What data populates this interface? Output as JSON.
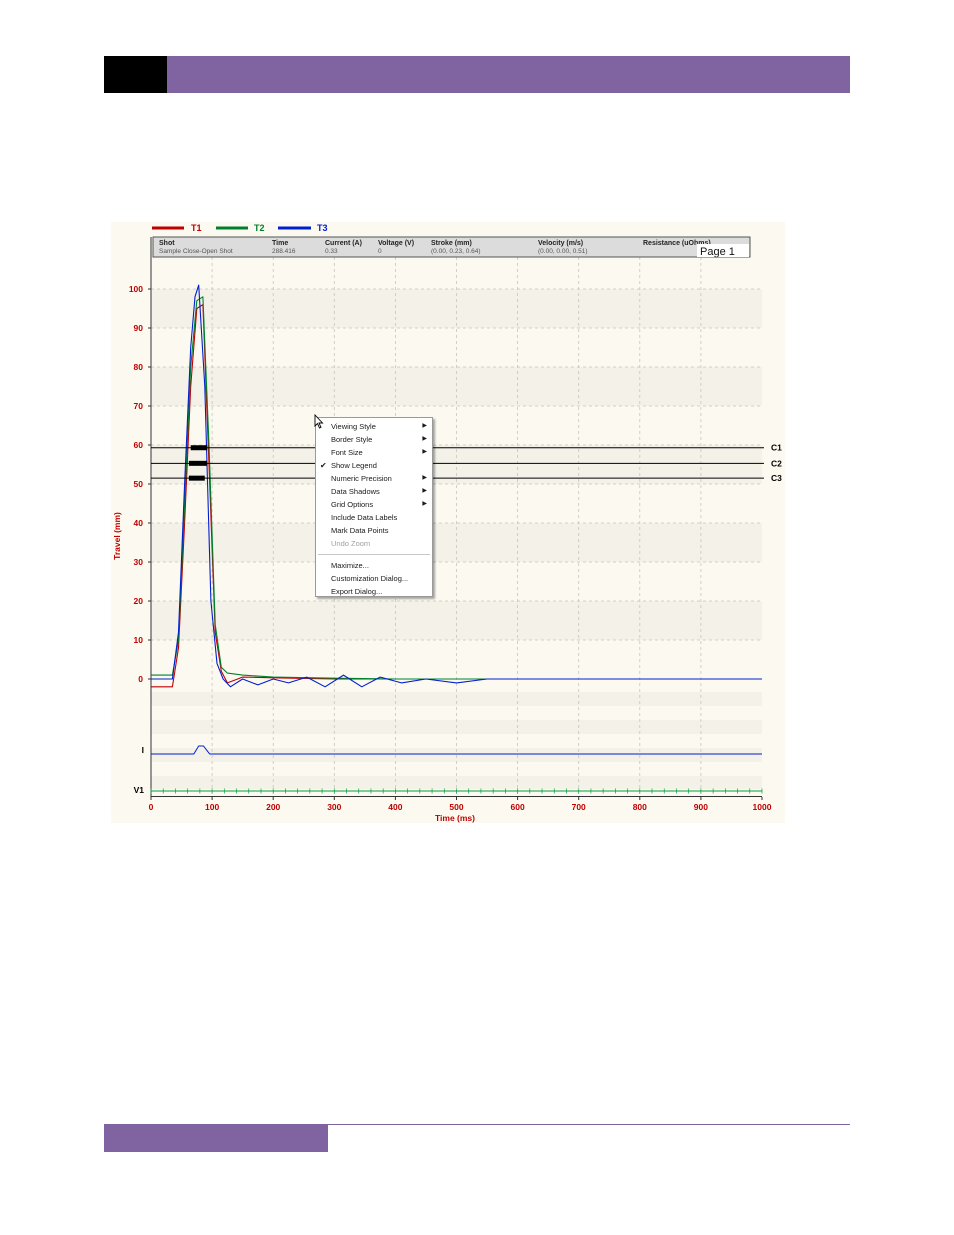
{
  "page": {
    "header_color": "#8064a2",
    "header_block_color": "#000000",
    "footer_color": "#8064a2"
  },
  "legend": [
    {
      "label": "T1",
      "color": "#c00000"
    },
    {
      "label": "T2",
      "color": "#00802b"
    },
    {
      "label": "T3",
      "color": "#0020d0"
    }
  ],
  "info_panel": {
    "columns": [
      {
        "header": "Shot",
        "value": "Sample Close-Open Shot"
      },
      {
        "header": "Time",
        "value": "288.416"
      },
      {
        "header": "Current (A)",
        "value": "0.33"
      },
      {
        "header": "Voltage (V)",
        "value": "0"
      },
      {
        "header": "Stroke (mm)",
        "value": "(0.00, 0.23, 0.64)"
      },
      {
        "header": "Velocity (m/s)",
        "value": "(0.00, 0.00, 0.51)"
      },
      {
        "header": "Resistance (uOhms)",
        "value": ""
      }
    ],
    "page_label": "Page 1"
  },
  "context_menu": {
    "items": [
      {
        "label": "Viewing Style",
        "submenu": true
      },
      {
        "label": "Border Style",
        "submenu": true
      },
      {
        "label": "Font Size",
        "submenu": true
      },
      {
        "label": "Show Legend",
        "checked": true
      },
      {
        "label": "Numeric Precision",
        "submenu": true
      },
      {
        "label": "Data Shadows",
        "submenu": true
      },
      {
        "label": "Grid Options",
        "submenu": true
      },
      {
        "label": "Include Data Labels"
      },
      {
        "label": "Mark Data Points"
      },
      {
        "label": "Undo Zoom",
        "disabled": true
      },
      {
        "separator": true
      },
      {
        "label": "Maximize..."
      },
      {
        "label": "Customization Dialog..."
      },
      {
        "label": "Export Dialog..."
      }
    ]
  },
  "chart_data": {
    "type": "line",
    "xlabel": "Time (ms)",
    "ylabel": "Travel (mm)",
    "xlim": [
      0,
      1000
    ],
    "ylim": [
      0,
      100
    ],
    "x_ticks": [
      "0",
      "100",
      "200",
      "300",
      "400",
      "500",
      "600",
      "700",
      "800",
      "900",
      "1000"
    ],
    "y_ticks": [
      "0",
      "10",
      "20",
      "30",
      "40",
      "50",
      "60",
      "70",
      "80",
      "90",
      "100"
    ],
    "grid": true,
    "axis_color": "#c00000",
    "series": [
      {
        "name": "T1",
        "color": "#c00000",
        "x": [
          0,
          35,
          45,
          55,
          65,
          75,
          85,
          95,
          105,
          115,
          125,
          150,
          200,
          300,
          400,
          500,
          600,
          800,
          1000
        ],
        "y": [
          -2,
          -2,
          8,
          40,
          75,
          95,
          96,
          55,
          12,
          2,
          -1,
          0.5,
          0.3,
          0,
          0,
          0,
          0,
          0,
          0
        ]
      },
      {
        "name": "T2",
        "color": "#00802b",
        "x": [
          0,
          35,
          45,
          55,
          65,
          75,
          85,
          95,
          105,
          115,
          125,
          150,
          200,
          300,
          400,
          500,
          600,
          800,
          1000
        ],
        "y": [
          1,
          1,
          10,
          45,
          80,
          97,
          98,
          60,
          14,
          3,
          1.5,
          1,
          0.5,
          0.2,
          0,
          0,
          0,
          0,
          0
        ]
      },
      {
        "name": "T3",
        "color": "#0020d0",
        "x": [
          0,
          35,
          45,
          55,
          65,
          72,
          78,
          88,
          98,
          108,
          118,
          130,
          150,
          175,
          200,
          225,
          255,
          285,
          315,
          345,
          375,
          410,
          450,
          500,
          550,
          600,
          700,
          800,
          1000
        ],
        "y": [
          0,
          0,
          12,
          50,
          85,
          98,
          101,
          75,
          20,
          4,
          0,
          -2,
          0,
          -1.5,
          0,
          -1,
          0.5,
          -2,
          1,
          -2,
          0.5,
          -1,
          0,
          -1,
          0,
          0,
          0,
          0,
          0
        ]
      }
    ],
    "contact_lines": [
      {
        "label": "C1",
        "y": 59.3
      },
      {
        "label": "C2",
        "y": 55.3
      },
      {
        "label": "C3",
        "y": 51.5
      }
    ],
    "contact_marks": [
      {
        "label": "C1",
        "x_start": 65,
        "x_end": 92,
        "y": 59.3
      },
      {
        "label": "C2",
        "x_start": 62,
        "x_end": 92,
        "y": 55.3
      },
      {
        "label": "C3",
        "x_start": 62,
        "x_end": 88,
        "y": 51.5
      }
    ],
    "aux_channels": [
      {
        "label": "I",
        "color": "#0020d0",
        "x": [
          0,
          70,
          78,
          86,
          92,
          96,
          1000
        ],
        "y": [
          0,
          0,
          1,
          1,
          0.4,
          0,
          0
        ]
      },
      {
        "label": "V1",
        "color": "#00a040",
        "x": [
          0,
          1000
        ],
        "y": [
          0,
          0
        ]
      }
    ]
  }
}
